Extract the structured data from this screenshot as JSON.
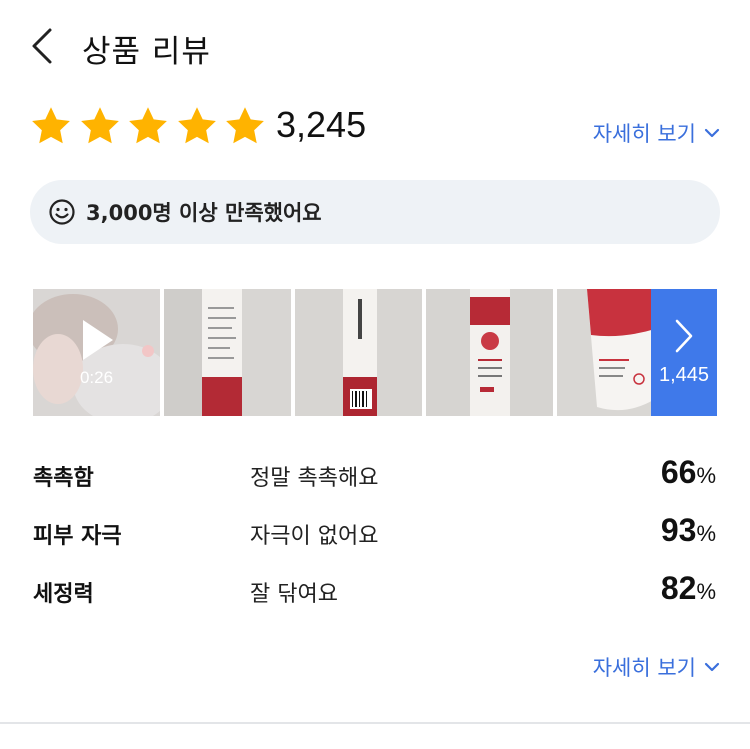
{
  "header": {
    "title": "상품 리뷰",
    "back_icon": "chevron-left-icon"
  },
  "rating": {
    "stars": 5,
    "max_stars": 5,
    "review_count": "3,245",
    "more_label": "자세히 보기",
    "star_color": "#ffb300"
  },
  "satisfaction": {
    "icon": "smile-icon",
    "text": "3,000명 이상 만족했어요"
  },
  "photos": {
    "video_duration": "0:26",
    "more_count": "1,445",
    "accent": "#3f79ea"
  },
  "attributes": [
    {
      "name": "촉촉함",
      "value": "정말 촉촉해요",
      "percent": "66",
      "unit": "%"
    },
    {
      "name": "피부 자극",
      "value": "자극이 없어요",
      "percent": "93",
      "unit": "%"
    },
    {
      "name": "세정력",
      "value": "잘 닦여요",
      "percent": "82",
      "unit": "%"
    }
  ],
  "footer": {
    "more_label": "자세히 보기"
  },
  "colors": {
    "link": "#3a6fdc",
    "pill_bg": "#eef2f6"
  }
}
